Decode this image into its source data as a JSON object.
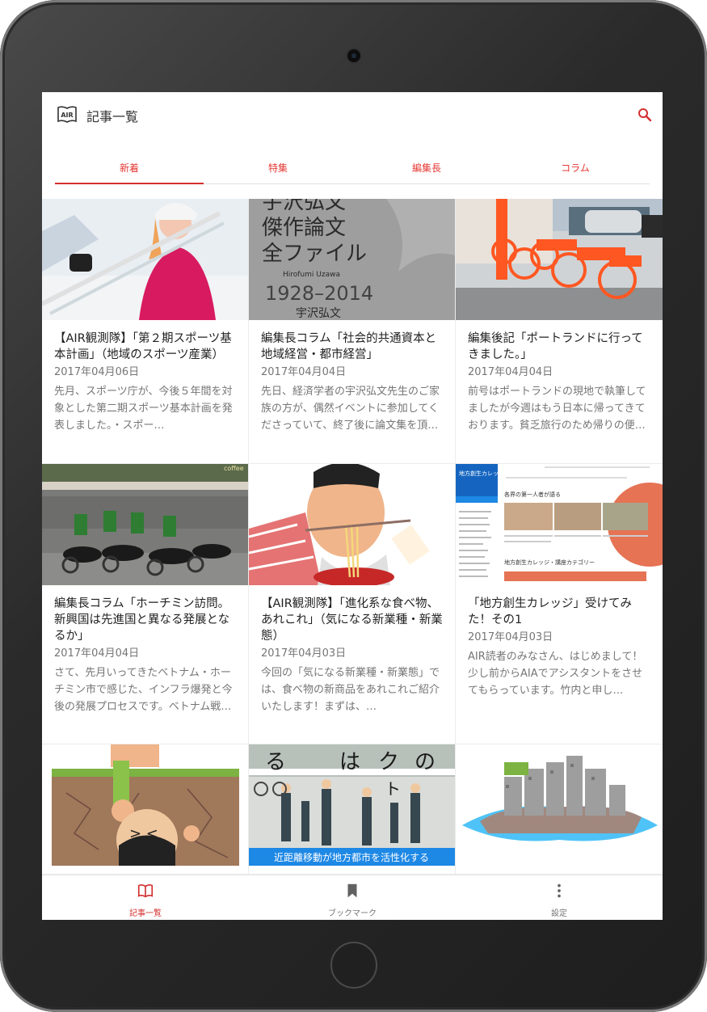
{
  "app": {
    "title": "記事一覧",
    "logo_text": "AIR"
  },
  "tabs": [
    {
      "label": "新着",
      "active": true
    },
    {
      "label": "特集",
      "active": false
    },
    {
      "label": "編集長",
      "active": false
    },
    {
      "label": "コラム",
      "active": false
    }
  ],
  "articles": [
    {
      "title": "【AIR観測隊】「第２期スポーツ基本計画」（地域のスポーツ産業）",
      "date": "2017年04月06日",
      "excerpt": "先月、スポーツ庁が、今後５年間を対象とした第二期スポーツ基本計画を発表しました。・スポー…",
      "image": "skier-photo"
    },
    {
      "title": "編集長コラム「社会的共通資本と地域経営・都市経営」",
      "date": "2017年04月04日",
      "excerpt": "先日、経済学者の宇沢弘文先生のご家族の方が、偶然イベントに参加してくださっていて、終了後に論文集を頂…",
      "image": "book-cover-photo"
    },
    {
      "title": "編集後記「ポートランドに行ってきました。」",
      "date": "2017年04月04日",
      "excerpt": "前号はポートランドの現地で執筆してましたが今週はもう日本に帰ってきております。貧乏旅行のため帰りの便…",
      "image": "bikes-photo"
    },
    {
      "title": "編集長コラム「ホーチミン訪問。新興国は先進国と異なる発展となるか」",
      "date": "2017年04月04日",
      "excerpt": "さて、先月いってきたベトナム・ホーチミン市で感じた、インフラ爆発と今後の発展プロセスです。ベトナム戦…",
      "image": "motorbikes-photo"
    },
    {
      "title": "【AIR観測隊】「進化系な食べ物、あれこれ」（気になる新業種・新業態）",
      "date": "2017年04月03日",
      "excerpt": "今回の「気になる新業種・新業態」では、食べ物の新商品をあれこれご紹介いたします！まずは、…",
      "image": "noodle-photo"
    },
    {
      "title": "「地方創生カレッジ」受けてみた！その1",
      "date": "2017年04月03日",
      "excerpt": "AIR読者のみなさん、はじめまして！少し前からAIAでアシスタントをさせてもらっています。竹内と申し…",
      "image": "website-screenshot"
    }
  ],
  "partial_row": [
    {
      "image": "cliff-illustration"
    },
    {
      "image": "street-photo",
      "caption": "近距離移動が地方都市を活性化する",
      "overlay_chars": [
        "る",
        "は",
        "ク",
        "の",
        "ト"
      ]
    },
    {
      "image": "island-illustration"
    }
  ],
  "thumb_texts": {
    "book": {
      "title_lines": [
        "宇沢弘文",
        "傑作論文",
        "全ファイル"
      ],
      "roman": "Hirofumi Uzawa",
      "years": "1928–2014",
      "author": "宇沢弘文"
    },
    "website": {
      "brand": "地方創生カレッジ",
      "heading": "各界の第一人者が語る",
      "category": "地方創生カレッジ・講座カテゴリー"
    },
    "storefront": "coffee"
  },
  "bottom_nav": [
    {
      "label": "記事一覧",
      "icon": "book-icon",
      "active": true
    },
    {
      "label": "ブックマーク",
      "icon": "bookmark-icon",
      "active": false
    },
    {
      "label": "設定",
      "icon": "more-vert-icon",
      "active": false
    }
  ],
  "colors": {
    "accent": "#d32f2f",
    "tab_text": "#e53935"
  }
}
